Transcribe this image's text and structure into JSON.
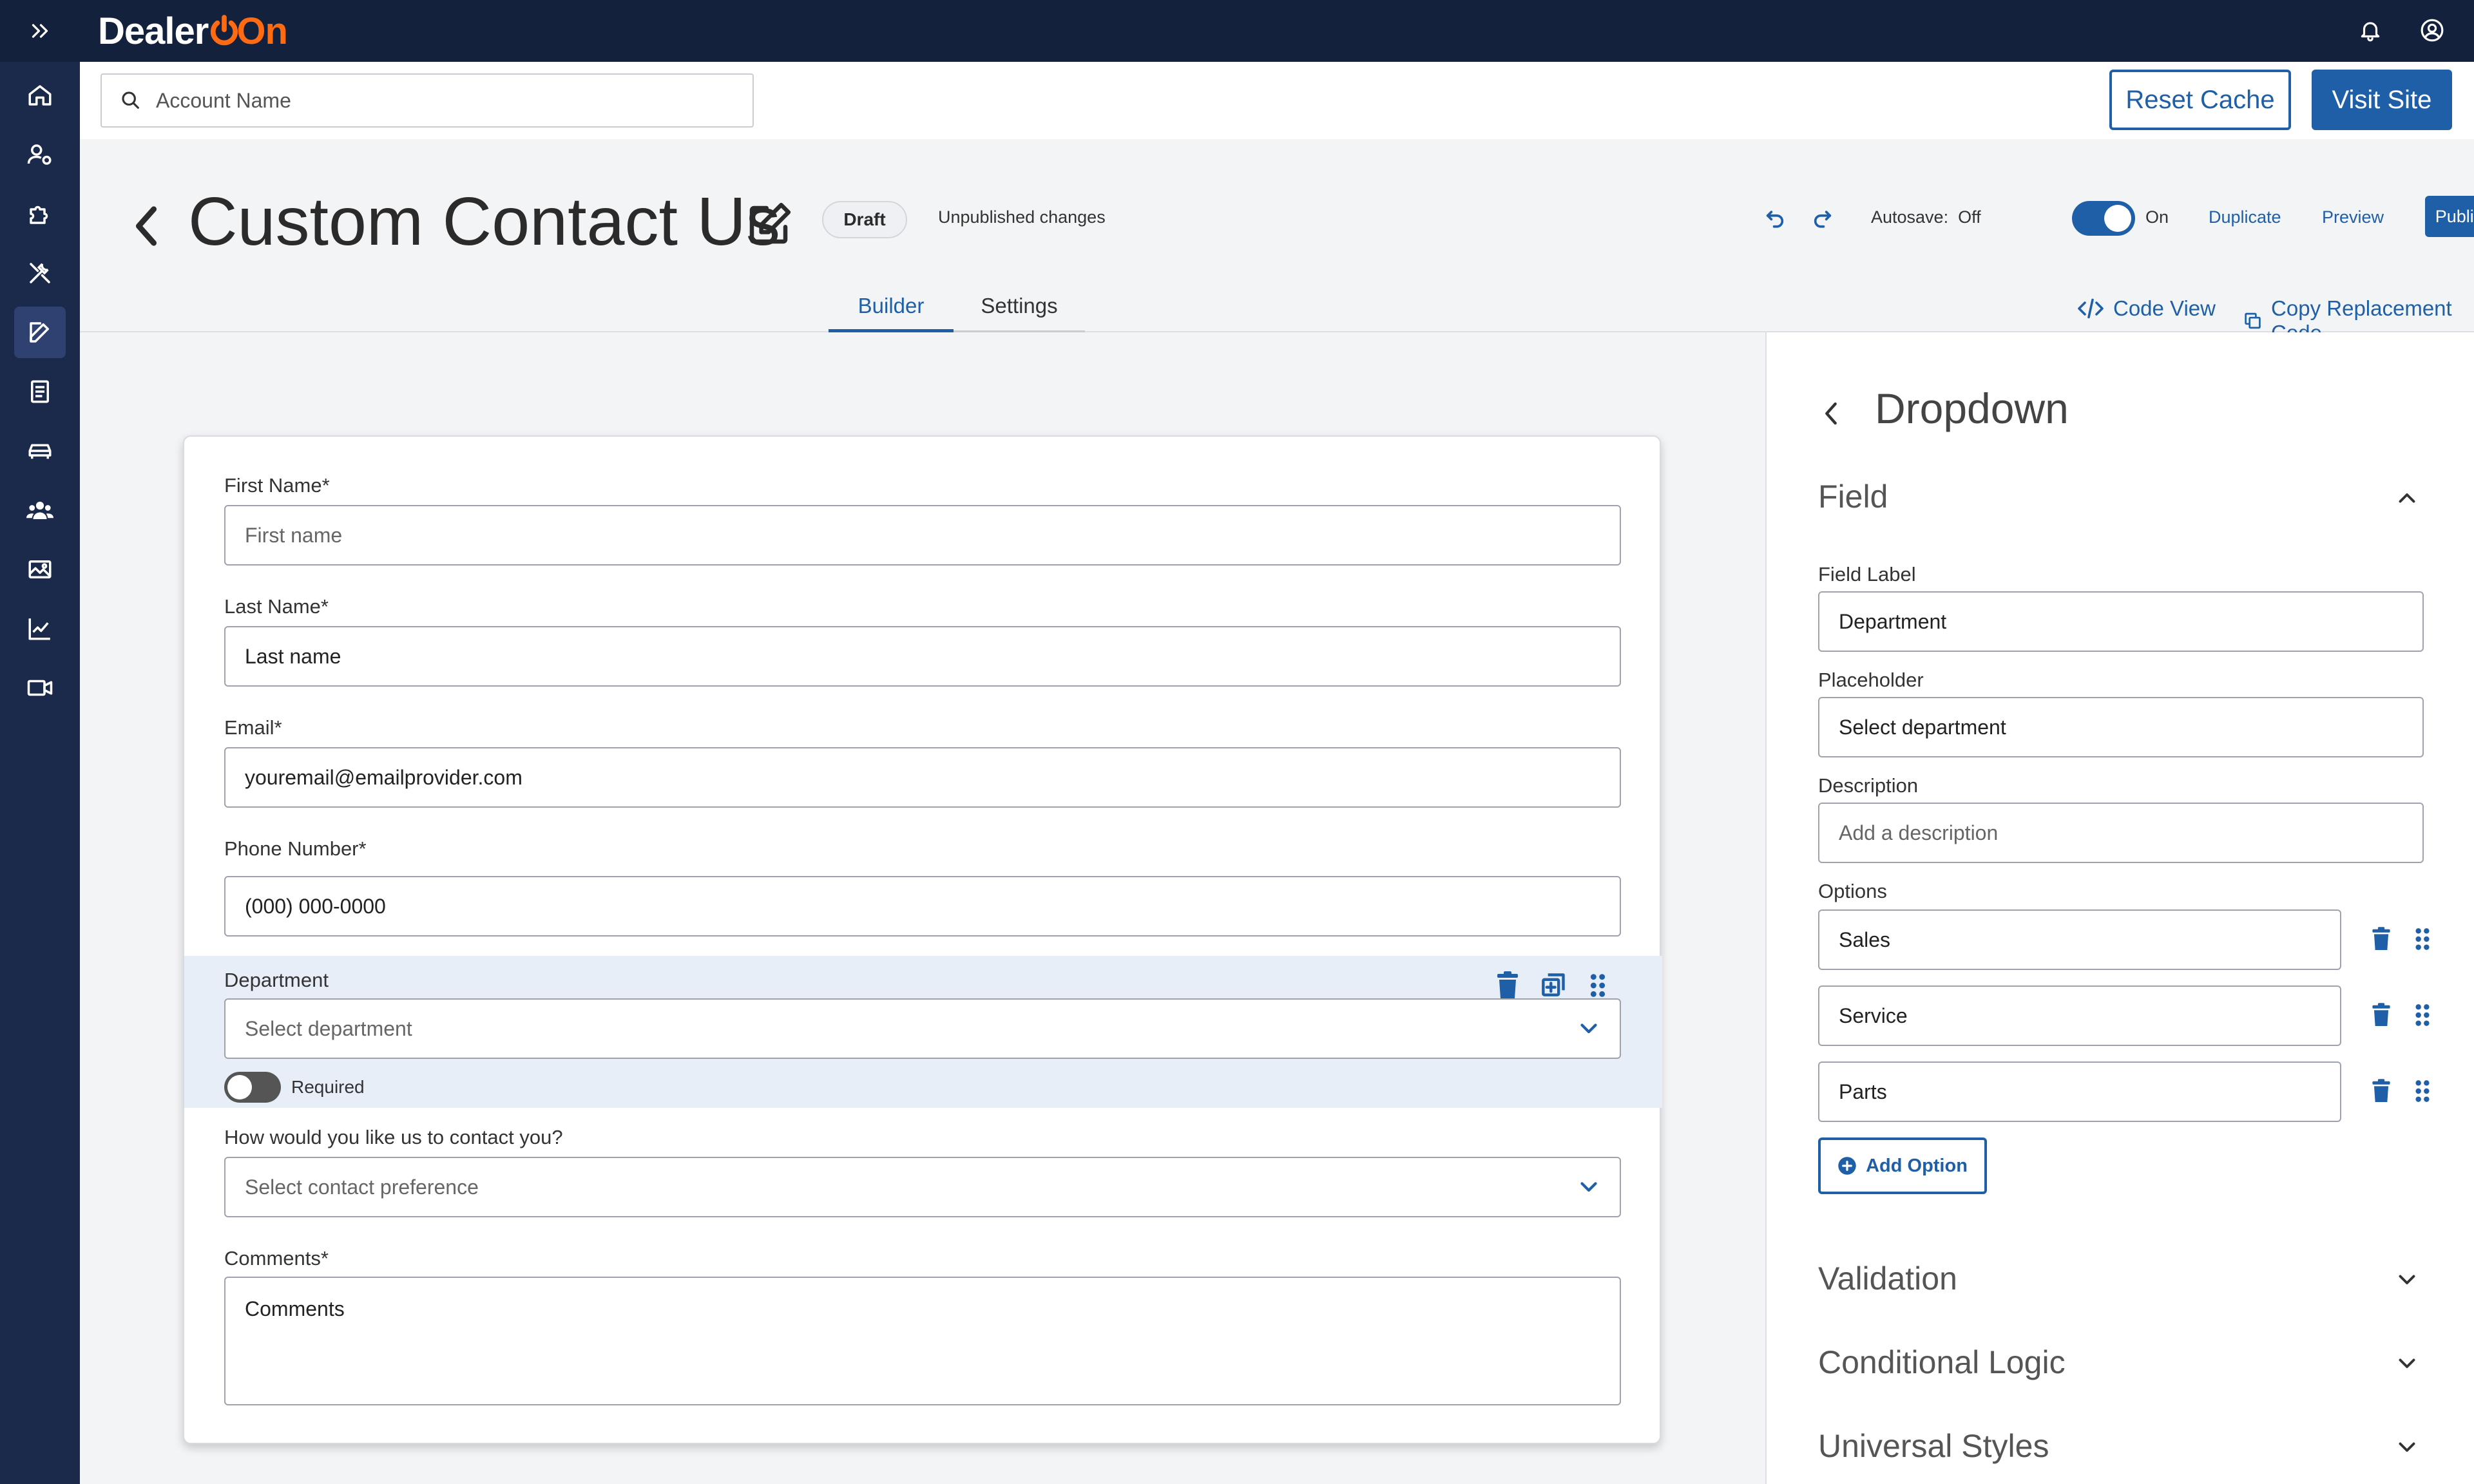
{
  "brand": {
    "name_prefix": "Dealer",
    "name_suffix": "On"
  },
  "account": {
    "search_placeholder": "Account Name",
    "reset_cache": "Reset Cache",
    "visit_site": "Visit Site"
  },
  "page": {
    "title": "Custom Contact Us",
    "status_badge": "Draft",
    "status_text": "Unpublished changes",
    "autosave_label": "Autosave:",
    "autosave_off": "Off",
    "autosave_on": "On",
    "autosave_enabled": true,
    "duplicate": "Duplicate",
    "preview": "Preview",
    "publish": "Publish"
  },
  "tabs": [
    {
      "label": "Builder",
      "active": true
    },
    {
      "label": "Settings",
      "active": false
    }
  ],
  "tools": {
    "code_view": "Code View",
    "copy_code": "Copy Replacement Code"
  },
  "form": {
    "first_name": {
      "label": "First Name*",
      "placeholder": "First name"
    },
    "last_name": {
      "label": "Last Name*",
      "value": "Last name"
    },
    "email": {
      "label": "Email*",
      "value": "youremail@emailprovider.com"
    },
    "phone": {
      "label": "Phone Number*",
      "value": "(000) 000-0000"
    },
    "department": {
      "label": "Department",
      "placeholder": "Select department",
      "required_label": "Required",
      "required": false
    },
    "contact_pref": {
      "label": "How would you like us to contact you?",
      "placeholder": "Select contact preference"
    },
    "comments": {
      "label": "Comments*",
      "value": "Comments"
    }
  },
  "panel": {
    "title": "Dropdown",
    "field_section": "Field",
    "field_label": {
      "label": "Field Label",
      "value": "Department"
    },
    "placeholder": {
      "label": "Placeholder",
      "value": "Select department"
    },
    "description": {
      "label": "Description",
      "placeholder": "Add a description"
    },
    "options_label": "Options",
    "options": [
      "Sales",
      "Service",
      "Parts"
    ],
    "add_option": "Add Option",
    "sections": [
      "Validation",
      "Conditional Logic",
      "Universal Styles"
    ]
  },
  "colors": {
    "accent": "#1f5fa8",
    "topbar": "#14213d",
    "rail": "#1b2a4a",
    "brand_orange": "#ff6a13",
    "selected_row": "#e8eef7"
  },
  "icons": {
    "rail": [
      "home-icon",
      "user-settings-icon",
      "puzzle-icon",
      "tools-icon",
      "edit-icon",
      "document-icon",
      "car-icon",
      "people-icon",
      "image-icon",
      "chart-icon",
      "video-icon"
    ]
  }
}
